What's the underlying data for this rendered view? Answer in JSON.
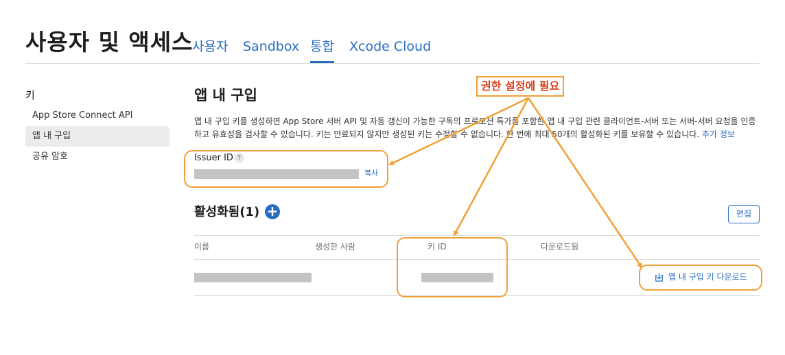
{
  "header": {
    "title": "사용자 및 액세스",
    "tabs": [
      {
        "label": "사용자"
      },
      {
        "label": "Sandbox"
      },
      {
        "label": "통합"
      },
      {
        "label": "Xcode Cloud"
      }
    ],
    "active_tab": "통합"
  },
  "sidebar": {
    "heading": "키",
    "items": [
      {
        "label": "App Store Connect API"
      },
      {
        "label": "앱 내 구입"
      },
      {
        "label": "공유 암호"
      }
    ],
    "active_item": "앱 내 구입"
  },
  "main": {
    "title": "앱 내 구입",
    "description": "앱 내 구입 키를 생성하면 App Store 서버 API 및 자동 갱신이 가능한 구독의 프로모션 특가를 포함한 앱 내 구입 관련 클라이언트-서버 또는 서버-서버 요청을 인증하고 유효성을 검사할 수 있습니다. 키는 만료되지 않지만 생성된 키는 수정할 수 없습니다. 한 번에 최대 50개의 활성화된 키를 보유할 수 있습니다.",
    "more_link": "추가 정보",
    "issuer": {
      "label": "Issuer ID",
      "help": "?",
      "copy_label": "복사"
    },
    "active_keys": {
      "title": "활성화됨(1)",
      "add_symbol": "+",
      "edit_label": "편집",
      "columns": [
        "이름",
        "생성한 사람",
        "키 ID",
        "다운로드됨"
      ],
      "download_label": "앱 내 구입 키 다운로드"
    }
  },
  "annotation": {
    "label": "권한 설정에 필요",
    "color": "#f0a035",
    "text_color": "#d9431d"
  },
  "colors": {
    "accent": "#2a6dc3",
    "redaction": "#c4c4c4"
  }
}
